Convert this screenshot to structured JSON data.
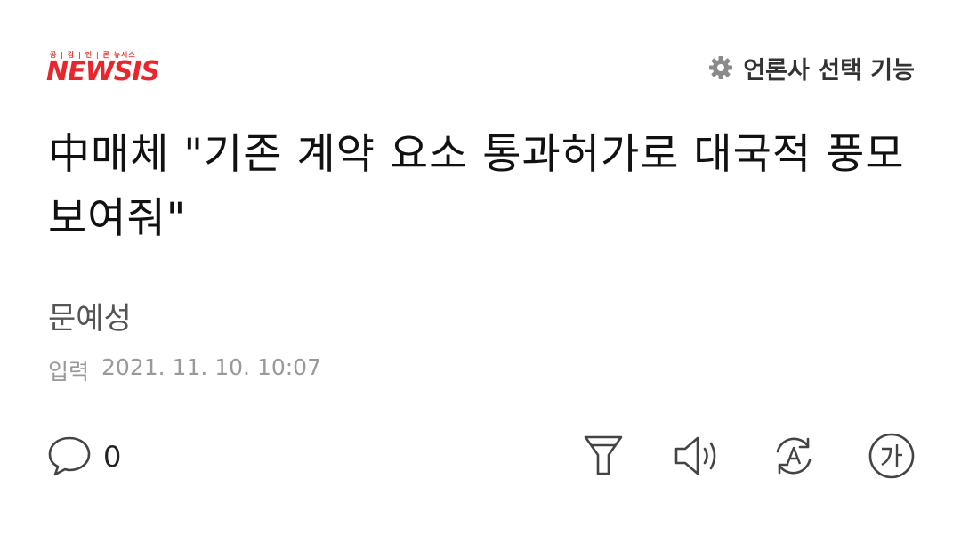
{
  "header": {
    "logo_tagline": "공 | 감 | 언 | 론 뉴시스",
    "logo_text": "NEWSIS",
    "press_select_label": "언론사 선택 기능"
  },
  "article": {
    "headline": "中매체 \"기존 계약 요소 통과허가로 대국적 풍모 보여줘\"",
    "author": "문예성",
    "date_label": "입력",
    "date_value": "2021. 11. 10. 10:07"
  },
  "toolbar": {
    "comment_count": "0",
    "icons": [
      "comment-icon",
      "summary-icon",
      "speaker-icon",
      "translate-icon",
      "font-size-icon"
    ]
  },
  "colors": {
    "brand_red": "#e8262b",
    "gear_gray": "#8a8a8a",
    "icon_gray": "#444444"
  }
}
